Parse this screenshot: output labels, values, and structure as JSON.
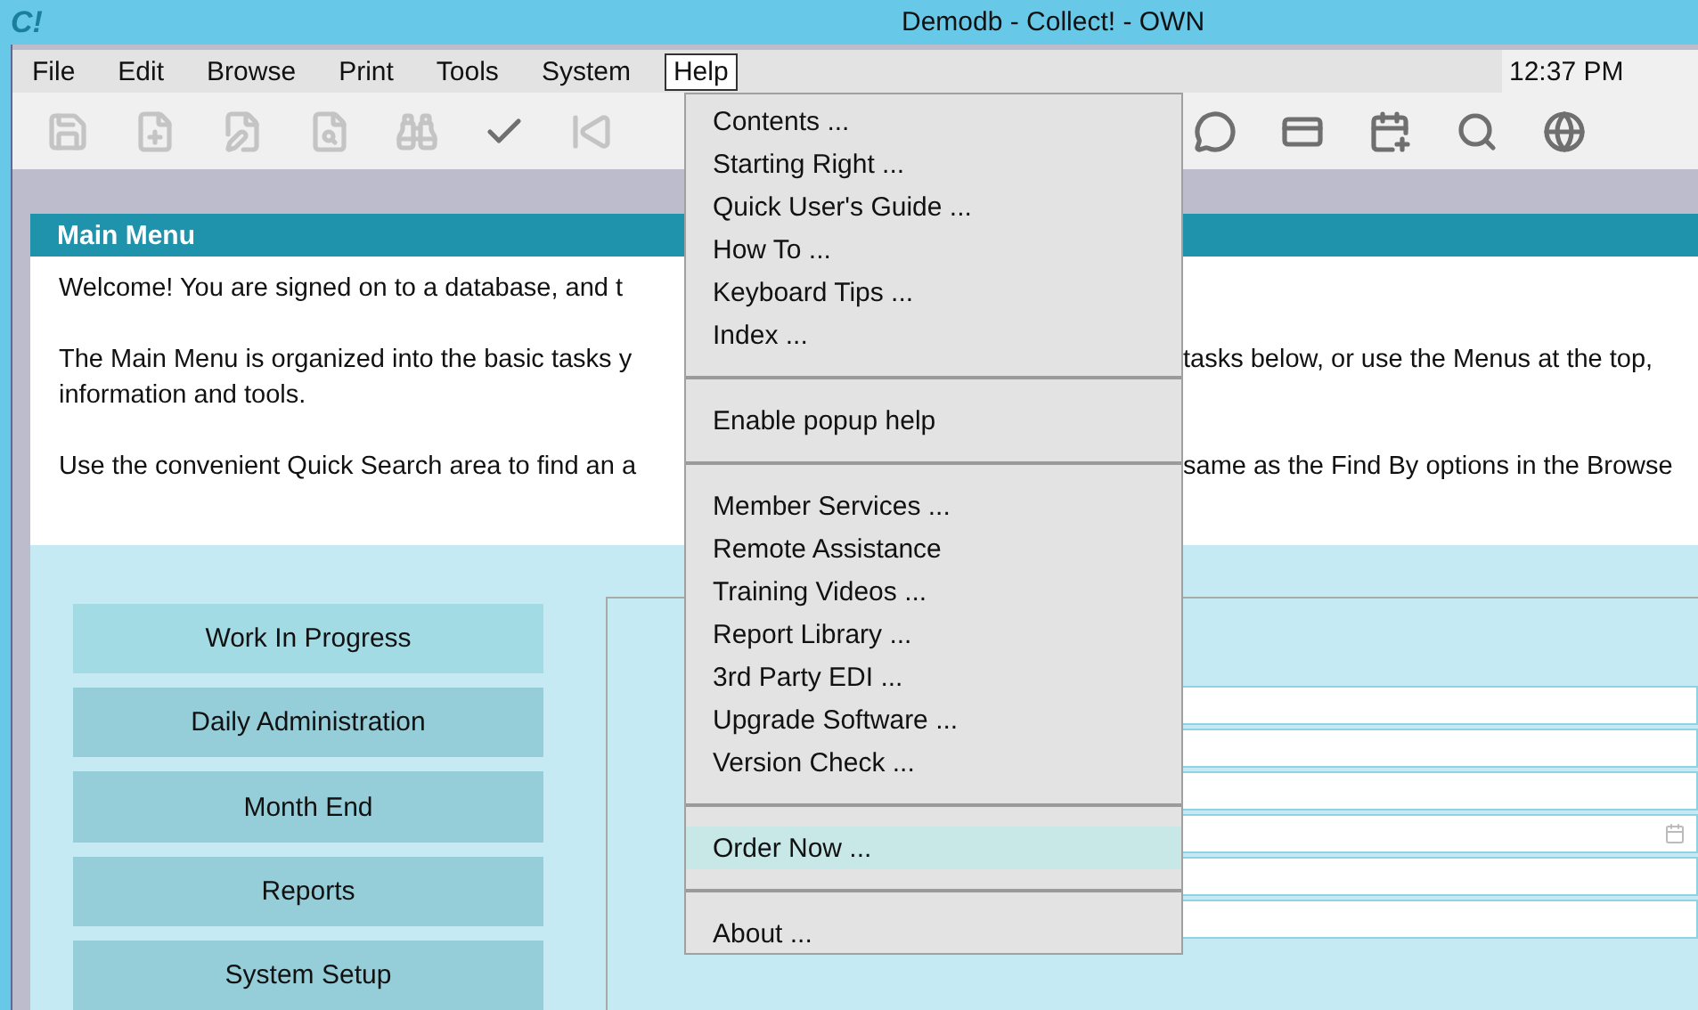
{
  "window": {
    "logo": "C!",
    "title": "Demodb - Collect! - OWN"
  },
  "menu_bar": {
    "items": [
      {
        "label": "File",
        "selected": false
      },
      {
        "label": "Edit",
        "selected": false
      },
      {
        "label": "Browse",
        "selected": false
      },
      {
        "label": "Print",
        "selected": false
      },
      {
        "label": "Tools",
        "selected": false
      },
      {
        "label": "System",
        "selected": false
      },
      {
        "label": "Help",
        "selected": true
      }
    ],
    "clock": "12:37 PM"
  },
  "toolbar": {
    "left": [
      {
        "kind": "save",
        "disabled": true
      },
      {
        "kind": "new",
        "disabled": true
      },
      {
        "kind": "edit",
        "disabled": true
      },
      {
        "kind": "preview",
        "disabled": true
      },
      {
        "kind": "find",
        "disabled": true
      },
      {
        "kind": "check",
        "disabled": false
      },
      {
        "kind": "first",
        "disabled": true
      }
    ],
    "right": [
      {
        "kind": "chat",
        "disabled": false
      },
      {
        "kind": "card",
        "disabled": false
      },
      {
        "kind": "calendar",
        "disabled": false
      },
      {
        "kind": "search",
        "disabled": false
      },
      {
        "kind": "globe",
        "disabled": false
      }
    ]
  },
  "main_menu": {
    "title": "Main Menu",
    "paragraphs": [
      {
        "left": "Welcome! You are signed on to a database, and t"
      },
      {
        "left": "The Main Menu is organized into the basic tasks y",
        "right": "tasks below, or use the Menus at the top,"
      },
      {
        "left": "information and tools."
      },
      {
        "left": "Use the convenient Quick Search area to find an a",
        "right": "same as the Find By options in the Browse"
      }
    ],
    "buttons": [
      {
        "label": "Work In Progress",
        "selected": true
      },
      {
        "label": "Daily Administration",
        "selected": false
      },
      {
        "label": "Month End",
        "selected": false
      },
      {
        "label": "Reports",
        "selected": false
      },
      {
        "label": "System Setup",
        "selected": false
      }
    ],
    "fields": [
      {
        "kind": "text"
      },
      {
        "kind": "text"
      },
      {
        "kind": "text"
      },
      {
        "kind": "date"
      },
      {
        "kind": "text"
      },
      {
        "kind": "text"
      }
    ]
  },
  "help_menu": [
    {
      "kind": "item",
      "label": "Contents ...",
      "selected": false
    },
    {
      "kind": "item",
      "label": "Starting Right ...",
      "selected": false
    },
    {
      "kind": "item",
      "label": "Quick User's Guide ...",
      "selected": false
    },
    {
      "kind": "item",
      "label": "How To ...",
      "selected": false
    },
    {
      "kind": "item",
      "label": "Keyboard Tips ...",
      "selected": false
    },
    {
      "kind": "item",
      "label": "Index ...",
      "selected": false
    },
    {
      "kind": "separator"
    },
    {
      "kind": "item",
      "label": "Enable popup help",
      "selected": false
    },
    {
      "kind": "separator"
    },
    {
      "kind": "item",
      "label": "Member Services ...",
      "selected": false
    },
    {
      "kind": "item",
      "label": "Remote Assistance",
      "selected": false
    },
    {
      "kind": "item",
      "label": "Training Videos ...",
      "selected": false
    },
    {
      "kind": "item",
      "label": "Report Library ...",
      "selected": false
    },
    {
      "kind": "item",
      "label": "3rd Party EDI ...",
      "selected": false
    },
    {
      "kind": "item",
      "label": "Upgrade Software ...",
      "selected": false
    },
    {
      "kind": "item",
      "label": "Version Check ...",
      "selected": false
    },
    {
      "kind": "separator"
    },
    {
      "kind": "item",
      "label": "Order Now ...",
      "selected": true
    },
    {
      "kind": "separator"
    },
    {
      "kind": "item",
      "label": "About ...",
      "selected": false
    }
  ]
}
